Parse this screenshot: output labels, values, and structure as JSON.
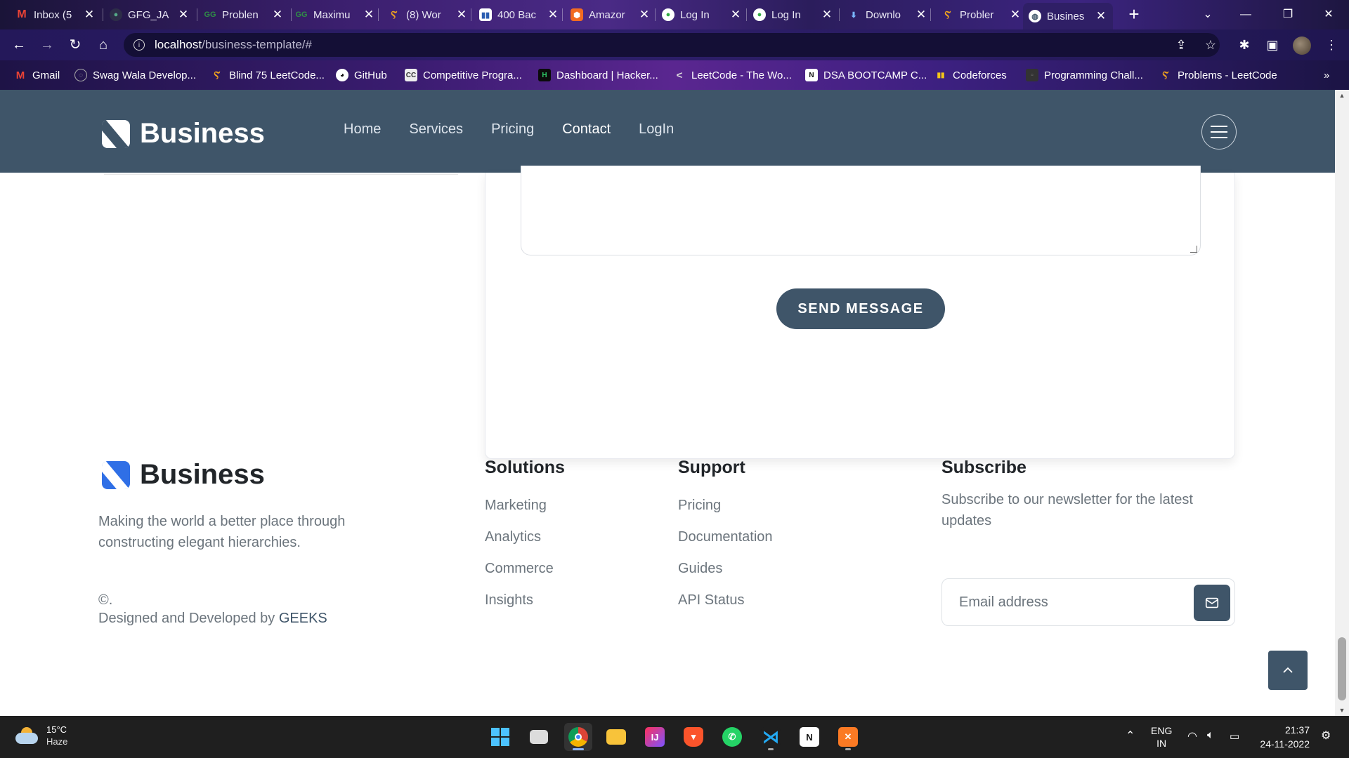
{
  "browser": {
    "tabs": [
      {
        "title": "Inbox (5",
        "icon": "gmail-icon"
      },
      {
        "title": "GFG_JA",
        "icon": "gfg-icon"
      },
      {
        "title": "Problen",
        "icon": "gfg-icon"
      },
      {
        "title": "Maximu",
        "icon": "gfg-icon"
      },
      {
        "title": "(8) Wor",
        "icon": "leetcode-icon"
      },
      {
        "title": "400 Bac",
        "icon": "chart-icon"
      },
      {
        "title": "Amazor",
        "icon": "amazon-icon"
      },
      {
        "title": "Log In",
        "icon": "globe-icon"
      },
      {
        "title": "Log In",
        "icon": "globe-icon"
      },
      {
        "title": "Downlo",
        "icon": "download-icon"
      },
      {
        "title": "Probler",
        "icon": "leetcode-icon"
      },
      {
        "title": "Busines",
        "icon": "globe-icon"
      }
    ],
    "url_host": "localhost",
    "url_path": "/business-template/#",
    "bookmarks": [
      {
        "label": "Gmail"
      },
      {
        "label": "Swag Wala Develop..."
      },
      {
        "label": "Blind 75 LeetCode..."
      },
      {
        "label": "GitHub"
      },
      {
        "label": "Competitive Progra..."
      },
      {
        "label": "Dashboard | Hacker..."
      },
      {
        "label": "LeetCode - The Wo..."
      },
      {
        "label": "DSA BOOTCAMP C..."
      },
      {
        "label": "Codeforces"
      },
      {
        "label": "Programming Chall..."
      },
      {
        "label": "Problems - LeetCode"
      }
    ],
    "more_bookmarks": "»"
  },
  "header": {
    "brand": "Business",
    "nav": [
      {
        "label": "Home"
      },
      {
        "label": "Services"
      },
      {
        "label": "Pricing"
      },
      {
        "label": "Contact"
      },
      {
        "label": "LogIn"
      }
    ],
    "active_nav": "Contact"
  },
  "contact": {
    "send_label": "SEND MESSAGE"
  },
  "footer": {
    "brand": "Business",
    "tagline": "Making the world a better place through constructing elegant hierarchies.",
    "copyright": "©.",
    "credit_prefix": "Designed and Developed by ",
    "credit_brand": "GEEKS",
    "solutions": {
      "title": "Solutions",
      "links": [
        "Marketing",
        "Analytics",
        "Commerce",
        "Insights"
      ]
    },
    "support": {
      "title": "Support",
      "links": [
        "Pricing",
        "Documentation",
        "Guides",
        "API Status"
      ]
    },
    "subscribe": {
      "title": "Subscribe",
      "text": "Subscribe to our newsletter for the latest updates",
      "placeholder": "Email address"
    }
  },
  "taskbar": {
    "temperature": "15°C",
    "condition": "Haze",
    "lang": "ENG",
    "region": "IN",
    "time": "21:37",
    "date": "24-11-2022"
  },
  "colors": {
    "header_bg": "#3f5569",
    "accent_blue": "#2f6fe6",
    "muted_text": "#6c757d"
  }
}
